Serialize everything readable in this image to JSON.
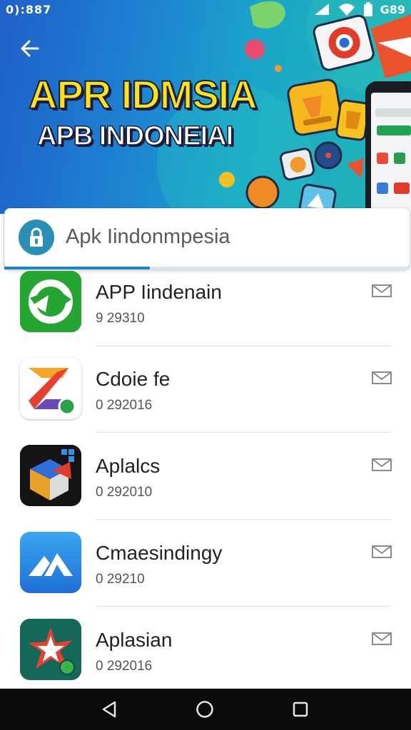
{
  "status_bar": {
    "time": "0):887",
    "battery_text": "G89"
  },
  "header": {
    "title_line1": "APR IDMSIA",
    "title_line2": "APB INDONEIAI",
    "back_icon": "arrow-left-icon"
  },
  "search": {
    "value": "Apk Iindonmpesia",
    "icon": "lock-icon",
    "progress_fraction": 0.36
  },
  "apps": [
    {
      "name": "APP Iindenain",
      "meta": "9 29310",
      "icon": "green-refresh-icon",
      "action_icon": "mail-icon"
    },
    {
      "name": "Cdoie fe",
      "meta": "0 292016",
      "icon": "colorful-z-icon",
      "action_icon": "mail-icon"
    },
    {
      "name": "Aplalcs",
      "meta": "0 292010",
      "icon": "3d-cube-icon",
      "action_icon": "mail-icon"
    },
    {
      "name": "Cmaesindingy",
      "meta": "0 29210",
      "icon": "blue-mountain-icon",
      "action_icon": "mail-icon"
    },
    {
      "name": "Aplasian",
      "meta": "0 292016",
      "icon": "star-burst-icon",
      "action_icon": "mail-icon"
    }
  ],
  "nav": {
    "back": "nav-back-icon",
    "home": "nav-home-icon",
    "recents": "nav-recents-icon"
  },
  "colors": {
    "banner_start": "#1f5fc9",
    "banner_end": "#23b7b5",
    "title_yellow": "#ffe11a",
    "accent": "#1c86c2",
    "lock_bg": "#2a8fb4"
  }
}
